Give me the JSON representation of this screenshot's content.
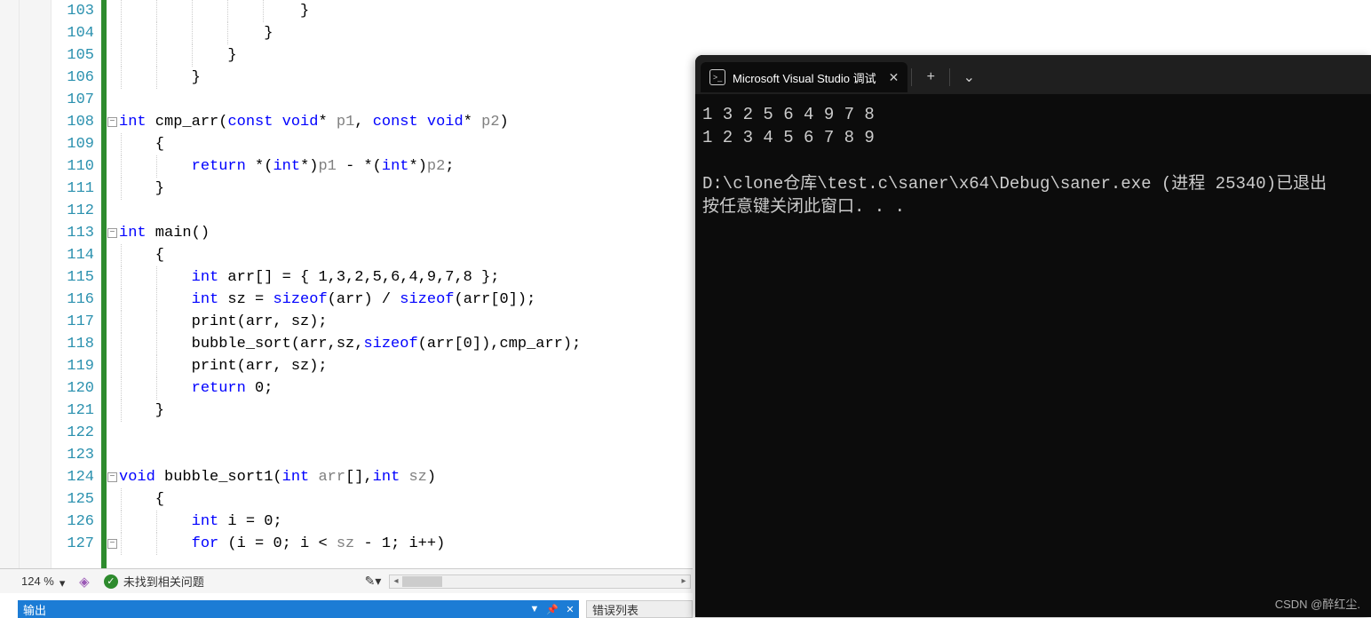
{
  "editor": {
    "zoom": "124 %",
    "status_text": "未找到相关问题",
    "line_start": 103,
    "lines": [
      {
        "n": 103,
        "indent": 5,
        "html": "}"
      },
      {
        "n": 104,
        "indent": 4,
        "html": "}"
      },
      {
        "n": 105,
        "indent": 3,
        "html": "}"
      },
      {
        "n": 106,
        "indent": 2,
        "html": "}"
      },
      {
        "n": 107,
        "indent": 0,
        "html": ""
      },
      {
        "n": 108,
        "fold": true,
        "indent": 0,
        "html": "<span class='kw'>int</span> cmp_arr(<span class='kw'>const</span> <span class='kw'>void</span>* <span class='param'>p1</span>, <span class='kw'>const</span> <span class='kw'>void</span>* <span class='param'>p2</span>)"
      },
      {
        "n": 109,
        "indent": 1,
        "html": "{"
      },
      {
        "n": 110,
        "indent": 2,
        "html": "<span class='kw'>return</span> *(<span class='kw'>int</span>*)<span class='param'>p1</span> - *(<span class='kw'>int</span>*)<span class='param'>p2</span>;"
      },
      {
        "n": 111,
        "indent": 1,
        "html": "}"
      },
      {
        "n": 112,
        "indent": 0,
        "html": ""
      },
      {
        "n": 113,
        "fold": true,
        "indent": 0,
        "html": "<span class='kw'>int</span> main()"
      },
      {
        "n": 114,
        "indent": 1,
        "html": "{"
      },
      {
        "n": 115,
        "indent": 2,
        "html": "<span class='kw'>int</span> arr[] = { 1,3,2,5,6,4,9,7,8 };"
      },
      {
        "n": 116,
        "indent": 2,
        "html": "<span class='kw'>int</span> sz = <span class='kw'>sizeof</span>(arr) / <span class='kw'>sizeof</span>(arr[0]);"
      },
      {
        "n": 117,
        "indent": 2,
        "html": "print(arr, sz);"
      },
      {
        "n": 118,
        "indent": 2,
        "html": "bubble_sort(arr,sz,<span class='kw'>sizeof</span>(arr[0]),cmp_arr);"
      },
      {
        "n": 119,
        "indent": 2,
        "html": "print(arr, sz);"
      },
      {
        "n": 120,
        "indent": 2,
        "html": "<span class='kw'>return</span> 0;"
      },
      {
        "n": 121,
        "indent": 1,
        "html": "}"
      },
      {
        "n": 122,
        "indent": 0,
        "html": ""
      },
      {
        "n": 123,
        "indent": 0,
        "html": ""
      },
      {
        "n": 124,
        "fold": true,
        "indent": 0,
        "html": "<span class='kw'>void</span> bubble_sort1(<span class='kw'>int</span> <span class='param'>arr</span>[],<span class='kw'>int</span> <span class='param'>sz</span>)"
      },
      {
        "n": 125,
        "indent": 1,
        "html": "{"
      },
      {
        "n": 126,
        "indent": 2,
        "html": "<span class='kw'>int</span> i = 0;"
      },
      {
        "n": 127,
        "fold": true,
        "indent": 2,
        "html": "<span class='kw'>for</span> (i = 0; i < <span class='param'>sz</span> - 1; i++)"
      }
    ]
  },
  "panels": {
    "output_label": "输出",
    "errors_label": "错误列表"
  },
  "console": {
    "tab_title": "Microsoft Visual Studio 调试",
    "tab_icon": "⧉",
    "output": [
      "1 3 2 5 6 4 9 7 8",
      "1 2 3 4 5 6 7 8 9",
      "",
      "D:\\clone仓库\\test.c\\saner\\x64\\Debug\\saner.exe (进程 25340)已退出",
      "按任意键关闭此窗口. . ."
    ]
  },
  "watermark": "CSDN @醉红尘."
}
